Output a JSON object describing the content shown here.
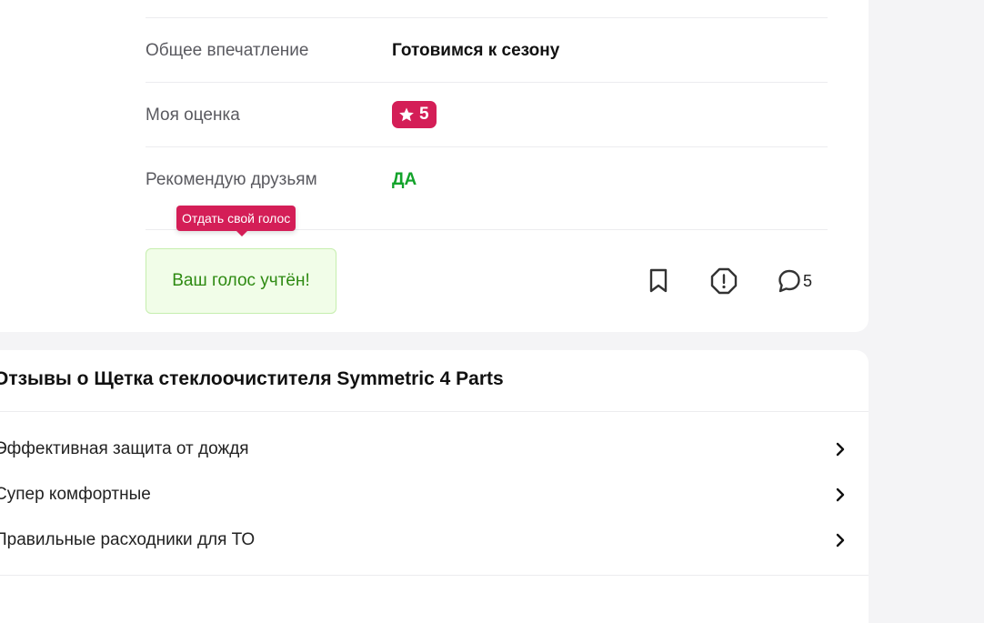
{
  "review": {
    "rows": [
      {
        "label": "Общее впечатление",
        "value": "Готовимся к сезону"
      },
      {
        "label": "Моя оценка",
        "value": "5"
      },
      {
        "label": "Рекомендую друзьям",
        "value": "ДА"
      }
    ],
    "tooltip": "Отдать свой голос",
    "vote_status": "Ваш голос учтён!",
    "comment_count": "5",
    "icons": {
      "bookmark": "bookmark-icon",
      "report": "report-icon",
      "comment": "comment-icon",
      "star": "star-icon"
    }
  },
  "reviews_section": {
    "title": "Отзывы о Щетка стеклоочистителя Symmetric 4 Parts",
    "items": [
      "Эффективная защита от дождя",
      "Супер комфортные",
      "Правильные расходники для ТО"
    ]
  },
  "colors": {
    "accent": "#d41e57",
    "positive": "#13a32b",
    "vote_bg": "#f1fde8"
  }
}
